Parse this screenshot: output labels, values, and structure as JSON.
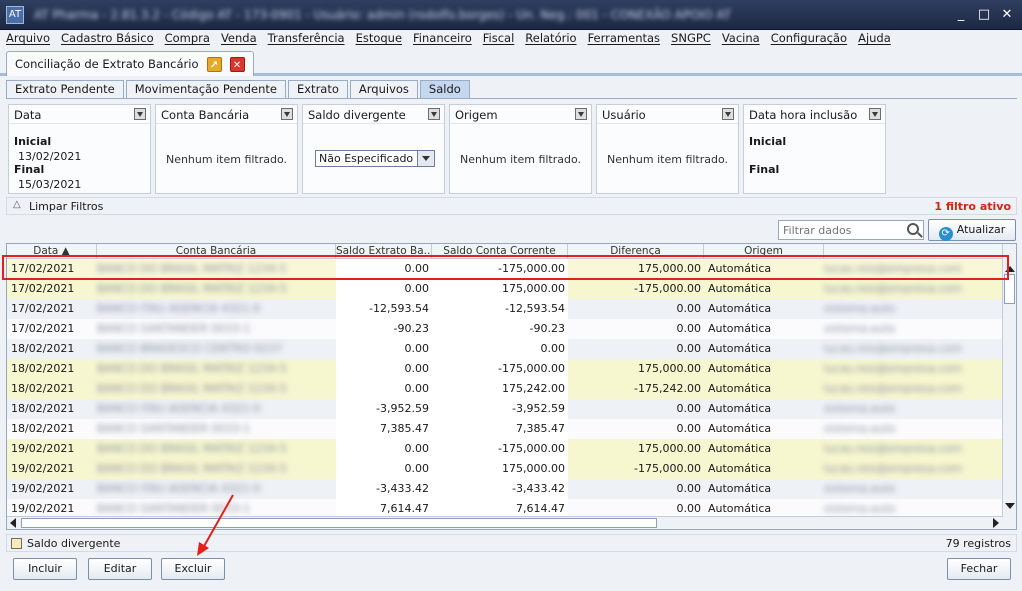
{
  "window": {
    "title": "AT Pharma - 2.81.3.2 - Código AT - 173-0901 - Usuário: admin (rodolfo.borges) - Un. Neg.: 001 - CONEXÃO APOIO AT"
  },
  "menu": [
    "Arquivo",
    "Cadastro Básico",
    "Compra",
    "Venda",
    "Transferência",
    "Estoque",
    "Financeiro",
    "Fiscal",
    "Relatório",
    "Ferramentas",
    "SNGPC",
    "Vacina",
    "Configuração",
    "Ajuda"
  ],
  "document_tab": {
    "label": "Conciliação de Extrato Bancário"
  },
  "sub_tabs": [
    "Extrato Pendente",
    "Movimentação Pendente",
    "Extrato",
    "Arquivos",
    "Saldo"
  ],
  "filters": {
    "data": {
      "header": "Data",
      "inicial_label": "Inicial",
      "inicial_value": "13/02/2021",
      "final_label": "Final",
      "final_value": "15/03/2021"
    },
    "conta": {
      "header": "Conta Bancária",
      "empty": "Nenhum item filtrado."
    },
    "saldo": {
      "header": "Saldo divergente",
      "selected": "Não Especificado"
    },
    "origem": {
      "header": "Origem",
      "empty": "Nenhum item filtrado."
    },
    "usuario": {
      "header": "Usuário",
      "empty": "Nenhum item filtrado."
    },
    "data_hora": {
      "header": "Data hora inclusão",
      "inicial_label": "Inicial",
      "final_label": "Final"
    }
  },
  "clear_filters": "Limpar Filtros",
  "active_filters": "1 filtro ativo",
  "search": {
    "placeholder": "Filtrar dados"
  },
  "refresh_label": "Atualizar",
  "table": {
    "columns": [
      "Data ▲",
      "Conta Bancária",
      "Saldo Extrato Ba...",
      "Saldo Conta Corrente",
      "Diferença",
      "Origem",
      ""
    ],
    "rows": [
      [
        "17/02/2021",
        "BANCO DO BRASIL MATRIZ 1234-5",
        "0.00",
        "-175,000.00",
        "175,000.00",
        "Automática",
        "lucas.reis@empresa.com"
      ],
      [
        "17/02/2021",
        "BANCO DO BRASIL MATRIZ 1234-5",
        "0.00",
        "175,000.00",
        "-175,000.00",
        "Automática",
        "lucas.reis@empresa.com"
      ],
      [
        "17/02/2021",
        "BANCO ITAU AGENCIA 4321-0",
        "-12,593.54",
        "-12,593.54",
        "0.00",
        "Automática",
        "sistema.auto"
      ],
      [
        "17/02/2021",
        "BANCO SANTANDER 0033-1",
        "-90.23",
        "-90.23",
        "0.00",
        "Automática",
        "sistema.auto"
      ],
      [
        "18/02/2021",
        "BANCO BRADESCO CENTRO 0237",
        "0.00",
        "0.00",
        "0.00",
        "Automática",
        "lucas.reis@empresa.com"
      ],
      [
        "18/02/2021",
        "BANCO DO BRASIL MATRIZ 1234-5",
        "0.00",
        "-175,000.00",
        "175,000.00",
        "Automática",
        "lucas.reis@empresa.com"
      ],
      [
        "18/02/2021",
        "BANCO DO BRASIL MATRIZ 1234-5",
        "0.00",
        "175,242.00",
        "-175,242.00",
        "Automática",
        "lucas.reis@empresa.com"
      ],
      [
        "18/02/2021",
        "BANCO ITAU AGENCIA 4321-0",
        "-3,952.59",
        "-3,952.59",
        "0.00",
        "Automática",
        "sistema.auto"
      ],
      [
        "18/02/2021",
        "BANCO SANTANDER 0033-1",
        "7,385.47",
        "7,385.47",
        "0.00",
        "Automática",
        "sistema.auto"
      ],
      [
        "19/02/2021",
        "BANCO DO BRASIL MATRIZ 1234-5",
        "0.00",
        "-175,000.00",
        "175,000.00",
        "Automática",
        "lucas.reis@empresa.com"
      ],
      [
        "19/02/2021",
        "BANCO DO BRASIL MATRIZ 1234-5",
        "0.00",
        "175,000.00",
        "-175,000.00",
        "Automática",
        "lucas.reis@empresa.com"
      ],
      [
        "19/02/2021",
        "BANCO ITAU AGENCIA 4321-0",
        "-3,433.42",
        "-3,433.42",
        "0.00",
        "Automática",
        "sistema.auto"
      ],
      [
        "19/02/2021",
        "BANCO SANTANDER 0033-1",
        "7,614.47",
        "7,614.47",
        "0.00",
        "Automática",
        "sistema.auto"
      ]
    ],
    "row_styles": [
      "sel",
      "hl",
      "even",
      "odd",
      "even",
      "hl",
      "hl",
      "even",
      "odd",
      "hl",
      "hl",
      "even",
      "odd"
    ]
  },
  "status": {
    "checkbox_label": "Saldo divergente",
    "count": "79 registros"
  },
  "buttons": {
    "incluir": "Incluir",
    "editar": "Editar",
    "excluir": "Excluir",
    "fechar": "Fechar"
  },
  "colors": {
    "highlight_box": "#e3201b",
    "active_filter_text": "#d4241a"
  }
}
